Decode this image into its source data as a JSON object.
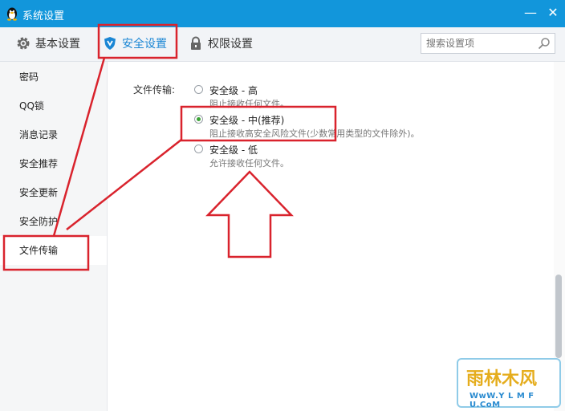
{
  "window": {
    "title": "系统设置",
    "minimize_symbol": "—",
    "close_symbol": "✕"
  },
  "tabs": [
    {
      "label": "基本设置",
      "icon": "gear-icon"
    },
    {
      "label": "安全设置",
      "icon": "shield-icon",
      "active": true
    },
    {
      "label": "权限设置",
      "icon": "lock-icon"
    }
  ],
  "search": {
    "placeholder": "搜索设置项",
    "icon": "search-icon"
  },
  "sidebar": {
    "items": [
      {
        "label": "密码"
      },
      {
        "label": "QQ锁"
      },
      {
        "label": "消息记录"
      },
      {
        "label": "安全推荐"
      },
      {
        "label": "安全更新"
      },
      {
        "label": "安全防护"
      },
      {
        "label": "文件传输",
        "active": true
      }
    ]
  },
  "file_transfer": {
    "label": "文件传输:",
    "options": [
      {
        "title": "安全级 - 高",
        "desc": "阻止接收任何文件。",
        "selected": false
      },
      {
        "title": "安全级 - 中(推荐)",
        "desc": "阻止接收高安全风险文件(少数常用类型的文件除外)。",
        "selected": true
      },
      {
        "title": "安全级 - 低",
        "desc": "允许接收任何文件。",
        "selected": false
      }
    ]
  },
  "watermark": {
    "line1": "雨林木风",
    "line2": "WwW.Y L M F U.CoM"
  },
  "colors": {
    "titlebar": "#1296db",
    "accent": "#1a86d4",
    "annotation": "#d9232d",
    "radio_checked": "#3aa335"
  }
}
